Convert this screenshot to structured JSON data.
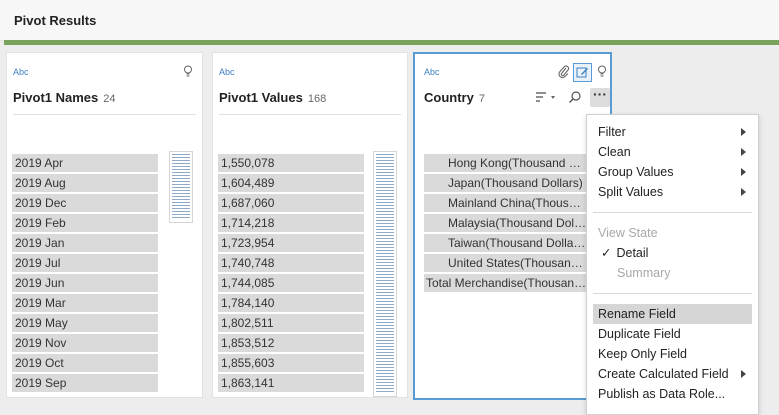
{
  "page": {
    "title": "Pivot Results"
  },
  "accent_color": "#79a35a",
  "selection_color": "#5b9bd5",
  "cards": [
    {
      "type_label": "Abc",
      "field_name": "Pivot1 Names",
      "count": "24",
      "values": [
        "2019 Apr",
        "2019 Aug",
        "2019 Dec",
        "2019 Feb",
        "2019 Jan",
        "2019 Jul",
        "2019 Jun",
        "2019 Mar",
        "2019 May",
        "2019 Nov",
        "2019 Oct",
        "2019 Sep"
      ]
    },
    {
      "type_label": "Abc",
      "field_name": "Pivot1 Values",
      "count": "168",
      "values": [
        "1,550,078",
        "1,604,489",
        "1,687,060",
        "1,714,218",
        "1,723,954",
        "1,740,748",
        "1,744,085",
        "1,784,140",
        "1,802,511",
        "1,853,512",
        "1,855,603",
        "1,863,141"
      ]
    },
    {
      "type_label": "Abc",
      "field_name": "Country",
      "count": "7",
      "values": [
        "Hong Kong(Thousand Dollars)",
        "Japan(Thousand Dollars)",
        "Mainland China(Thousand Dollars)",
        "Malaysia(Thousand Dollars)",
        "Taiwan(Thousand Dollars)",
        "United States(Thousand Dollars)",
        "Total Merchandise(Thousand Dollars)"
      ],
      "icons": [
        "paperclip-icon",
        "edit-icon",
        "lightbulb-icon",
        "sort-icon",
        "search-icon",
        "more-icon"
      ]
    }
  ],
  "context_menu": {
    "group1": [
      {
        "label": "Filter",
        "submenu": true
      },
      {
        "label": "Clean",
        "submenu": true
      },
      {
        "label": "Group Values",
        "submenu": true
      },
      {
        "label": "Split Values",
        "submenu": true
      }
    ],
    "view_state_label": "View State",
    "view_detail": "Detail",
    "view_summary": "Summary",
    "check_glyph": "✓",
    "group3": [
      {
        "label": "Rename Field",
        "highlighted": true
      },
      {
        "label": "Duplicate Field"
      },
      {
        "label": "Keep Only Field"
      },
      {
        "label": "Create Calculated Field",
        "submenu": true
      },
      {
        "label": "Publish as Data Role..."
      }
    ]
  }
}
